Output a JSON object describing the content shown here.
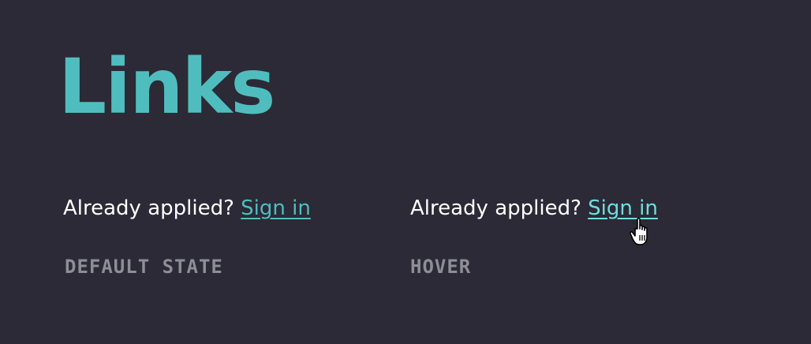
{
  "page": {
    "title": "Links"
  },
  "examples": [
    {
      "prompt": "Already applied?",
      "link_label": "Sign in",
      "caption": "DEFAULT STATE"
    },
    {
      "prompt": "Already applied?",
      "link_label": "Sign in",
      "caption": "HOVER"
    }
  ],
  "colors": {
    "background": "#2b2a36",
    "accent": "#4fbdbd",
    "accent_hover": "#6fdede",
    "caption": "#8e8e96",
    "text": "#ffffff"
  },
  "icons": {
    "cursor": "hand-pointer-icon"
  }
}
